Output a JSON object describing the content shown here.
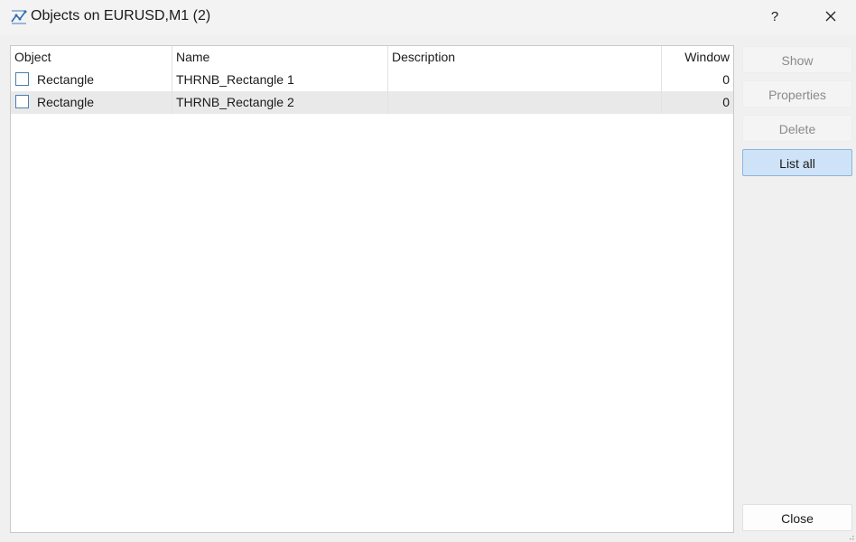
{
  "window": {
    "title": "Objects on EURUSD,M1 (2)",
    "app_icon": "chart-line-icon",
    "help_label": "?",
    "close_icon": "close-icon"
  },
  "table": {
    "columns": [
      "Object",
      "Name",
      "Description",
      "Window"
    ],
    "rows": [
      {
        "object": "Rectangle",
        "name": "THRNB_Rectangle 1",
        "description": "",
        "window": "0",
        "checked": false
      },
      {
        "object": "Rectangle",
        "name": "THRNB_Rectangle 2",
        "description": "",
        "window": "0",
        "checked": false
      }
    ]
  },
  "buttons": {
    "show": "Show",
    "properties": "Properties",
    "delete": "Delete",
    "list_all": "List all",
    "close": "Close"
  },
  "colors": {
    "accent": "#cfe3f8",
    "checkbox_border": "#4a7fb0"
  }
}
